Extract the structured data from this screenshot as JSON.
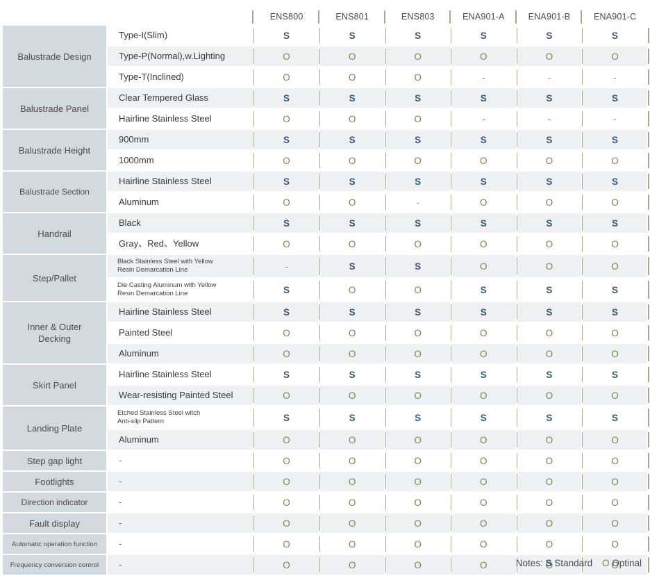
{
  "table": {
    "corner_blank": "",
    "models": [
      "ENS800",
      "ENS801",
      "ENS803",
      "ENA901-A",
      "ENA901-B",
      "ENA901-C"
    ],
    "rows": [
      {
        "category": "Balustrade Design",
        "category_rowspan": 3,
        "category_size": "normal",
        "feature": "Type-I(Slim)",
        "feature_lines": [
          "Type-I(Slim)"
        ],
        "values": [
          "S",
          "S",
          "S",
          "S",
          "S",
          "S"
        ]
      },
      {
        "category": null,
        "feature": "Type-P(Normal),w.Lighting",
        "feature_lines": [
          "Type-P(Normal),w.Lighting"
        ],
        "values": [
          "O",
          "O",
          "O",
          "O",
          "O",
          "O"
        ]
      },
      {
        "category": null,
        "feature": "Type-T(Inclined)",
        "feature_lines": [
          "Type-T(Inclined)"
        ],
        "values": [
          "O",
          "O",
          "O",
          "-",
          "-",
          "-"
        ]
      },
      {
        "category": "Balustrade Panel",
        "category_rowspan": 2,
        "category_size": "normal",
        "feature": "Clear Tempered Glass",
        "feature_lines": [
          "Clear Tempered Glass"
        ],
        "values": [
          "S",
          "S",
          "S",
          "S",
          "S",
          "S"
        ]
      },
      {
        "category": null,
        "feature": "Hairline Stainless Steel",
        "feature_lines": [
          "Hairline Stainless Steel"
        ],
        "values": [
          "O",
          "O",
          "O",
          "-",
          "-",
          "-"
        ]
      },
      {
        "category": "Balustrade Height",
        "category_rowspan": 2,
        "category_size": "normal",
        "feature": "900mm",
        "feature_lines": [
          "900mm"
        ],
        "values": [
          "S",
          "S",
          "S",
          "S",
          "S",
          "S"
        ]
      },
      {
        "category": null,
        "feature": "1000mm",
        "feature_lines": [
          "1000mm"
        ],
        "values": [
          "O",
          "O",
          "O",
          "O",
          "O",
          "O"
        ]
      },
      {
        "category": "Balustrade Section",
        "category_rowspan": 2,
        "category_size": "small",
        "feature": "Hairline Stainless Steel",
        "feature_lines": [
          "Hairline Stainless Steel"
        ],
        "values": [
          "S",
          "S",
          "S",
          "S",
          "S",
          "S"
        ]
      },
      {
        "category": null,
        "feature": "Aluminum",
        "feature_lines": [
          "Aluminum"
        ],
        "values": [
          "O",
          "O",
          "-",
          "O",
          "O",
          "O"
        ]
      },
      {
        "category": "Handrail",
        "category_rowspan": 2,
        "category_size": "normal",
        "feature": "Black",
        "feature_lines": [
          "Black"
        ],
        "values": [
          "S",
          "S",
          "S",
          "S",
          "S",
          "S"
        ]
      },
      {
        "category": null,
        "feature": "Gray、Red、Yellow",
        "feature_lines": [
          "Gray、Red、Yellow"
        ],
        "values": [
          "O",
          "O",
          "O",
          "O",
          "O",
          "O"
        ]
      },
      {
        "category": "Step/Pallet",
        "category_rowspan": 2,
        "category_size": "normal",
        "feature": "Black Stainless Steel with Yellow Resin Demarcation Line",
        "feature_lines": [
          "Black Stainless Steel with Yellow",
          "Resin Demarcation Line"
        ],
        "values": [
          "-",
          "S",
          "S",
          "O",
          "O",
          "O"
        ]
      },
      {
        "category": null,
        "feature": "Die Casting Aluminum with Yellow Resin Demarcation Line",
        "feature_lines": [
          "Die Casting Aluminum with Yellow",
          "Resin Demarcation Line"
        ],
        "values": [
          "S",
          "O",
          "O",
          "S",
          "S",
          "S"
        ]
      },
      {
        "category": "Inner & Outer Decking",
        "category_rowspan": 3,
        "category_size": "normal",
        "category_lines": [
          "Inner & Outer",
          "Decking"
        ],
        "feature": "Hairline Stainless Steel",
        "feature_lines": [
          "Hairline Stainless Steel"
        ],
        "values": [
          "S",
          "S",
          "S",
          "S",
          "S",
          "S"
        ]
      },
      {
        "category": null,
        "feature": "Painted Steel",
        "feature_lines": [
          "Painted Steel"
        ],
        "values": [
          "O",
          "O",
          "O",
          "O",
          "O",
          "O"
        ]
      },
      {
        "category": null,
        "feature": "Aluminum",
        "feature_lines": [
          "Aluminum"
        ],
        "values": [
          "O",
          "O",
          "O",
          "O",
          "O",
          "O"
        ]
      },
      {
        "category": "Skirt Panel",
        "category_rowspan": 2,
        "category_size": "normal",
        "feature": "Hairline Stainless Steel",
        "feature_lines": [
          "Hairline Stainless Steel"
        ],
        "values": [
          "S",
          "S",
          "S",
          "S",
          "S",
          "S"
        ]
      },
      {
        "category": null,
        "feature": "Wear-resisting Painted Steel",
        "feature_lines": [
          "Wear-resisting Painted Steel"
        ],
        "values": [
          "O",
          "O",
          "O",
          "O",
          "O",
          "O"
        ]
      },
      {
        "category": "Landing Plate",
        "category_rowspan": 2,
        "category_size": "normal",
        "feature": "Etched Stainless Steel witch Anti-slip Pattern",
        "feature_lines": [
          "Etched Stainless Steel witch",
          "Anti-slip Pattern"
        ],
        "values": [
          "S",
          "S",
          "S",
          "S",
          "S",
          "S"
        ]
      },
      {
        "category": null,
        "feature": "Aluminum",
        "feature_lines": [
          "Aluminum"
        ],
        "values": [
          "O",
          "O",
          "O",
          "O",
          "O",
          "O"
        ]
      },
      {
        "category": "Step gap light",
        "category_rowspan": 1,
        "category_size": "normal",
        "feature": "-",
        "feature_lines": [
          "-"
        ],
        "values": [
          "O",
          "O",
          "O",
          "O",
          "O",
          "O"
        ]
      },
      {
        "category": "Footlights",
        "category_rowspan": 1,
        "category_size": "normal",
        "feature": "-",
        "feature_lines": [
          "-"
        ],
        "values": [
          "O",
          "O",
          "O",
          "O",
          "O",
          "O"
        ]
      },
      {
        "category": "Direction indicator",
        "category_rowspan": 1,
        "category_size": "small",
        "feature": "-",
        "feature_lines": [
          "-"
        ],
        "values": [
          "O",
          "O",
          "O",
          "O",
          "O",
          "O"
        ]
      },
      {
        "category": "Fault display",
        "category_rowspan": 1,
        "category_size": "normal",
        "feature": "-",
        "feature_lines": [
          "-"
        ],
        "values": [
          "O",
          "O",
          "O",
          "O",
          "O",
          "O"
        ]
      },
      {
        "category": "Automatic operation function",
        "category_rowspan": 1,
        "category_size": "tiny",
        "feature": "-",
        "feature_lines": [
          "-"
        ],
        "values": [
          "O",
          "O",
          "O",
          "O",
          "O",
          "O"
        ]
      },
      {
        "category": "Frequency conversion control",
        "category_rowspan": 1,
        "category_size": "tiny",
        "feature": "-",
        "feature_lines": [
          "-"
        ],
        "values": [
          "O",
          "O",
          "O",
          "O",
          "O",
          "O"
        ]
      }
    ]
  },
  "notes": {
    "label": "Notes:",
    "standard_symbol": "S",
    "standard_text": "Standard",
    "optional_symbol": "O",
    "optional_text": "Optinal"
  },
  "colors": {
    "standard": "#36597e",
    "optional": "#6f8b4a",
    "category_bg": "#d2d9df",
    "header_bg": "#c9ced2",
    "row_even_bg": "#eef0f1",
    "separator": "#a9a983"
  }
}
